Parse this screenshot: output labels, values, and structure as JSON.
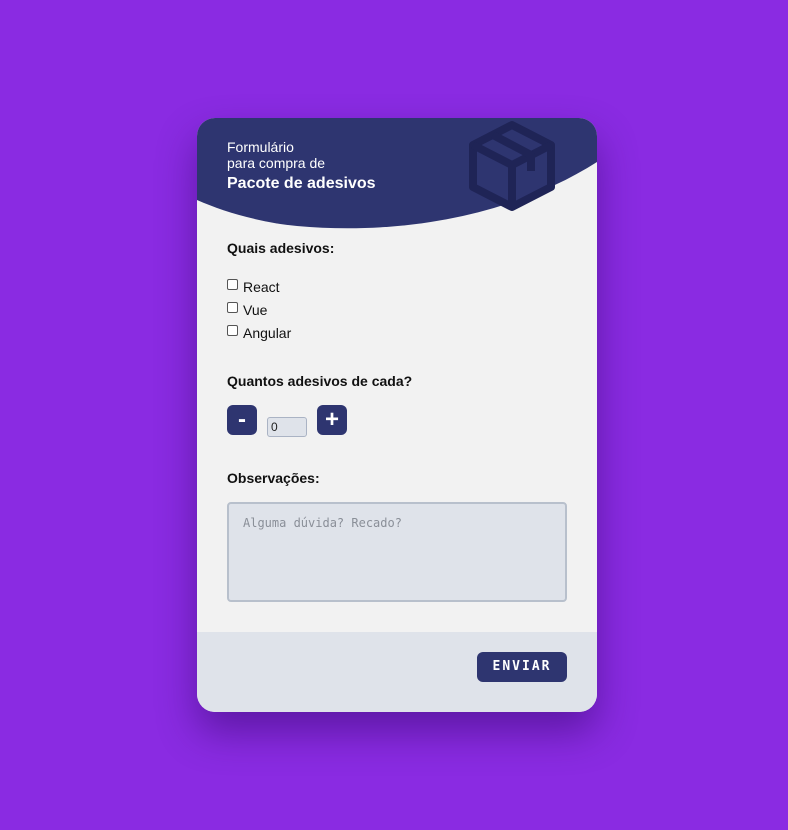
{
  "header": {
    "line1": "Formulário",
    "line2": "para compra de",
    "title": "Pacote de adesivos",
    "icon": "package-box-icon",
    "bg_color": "#2e3570",
    "icon_color": "#1f2456"
  },
  "stickers": {
    "label": "Quais adesivos:",
    "options": [
      {
        "label": "React",
        "checked": false
      },
      {
        "label": "Vue",
        "checked": false
      },
      {
        "label": "Angular",
        "checked": false
      }
    ]
  },
  "quantity": {
    "label": "Quantos adesivos de cada?",
    "minus_label": "-",
    "plus_label": "+",
    "value": "0"
  },
  "notes": {
    "label": "Observações:",
    "placeholder": "Alguma dúvida? Recado?"
  },
  "footer": {
    "submit_label": "ENVIAR"
  },
  "colors": {
    "page_bg": "#8a2be2",
    "card_bg": "#f2f2f2",
    "accent": "#2e3570",
    "footer_bg": "#dfe3ea"
  }
}
